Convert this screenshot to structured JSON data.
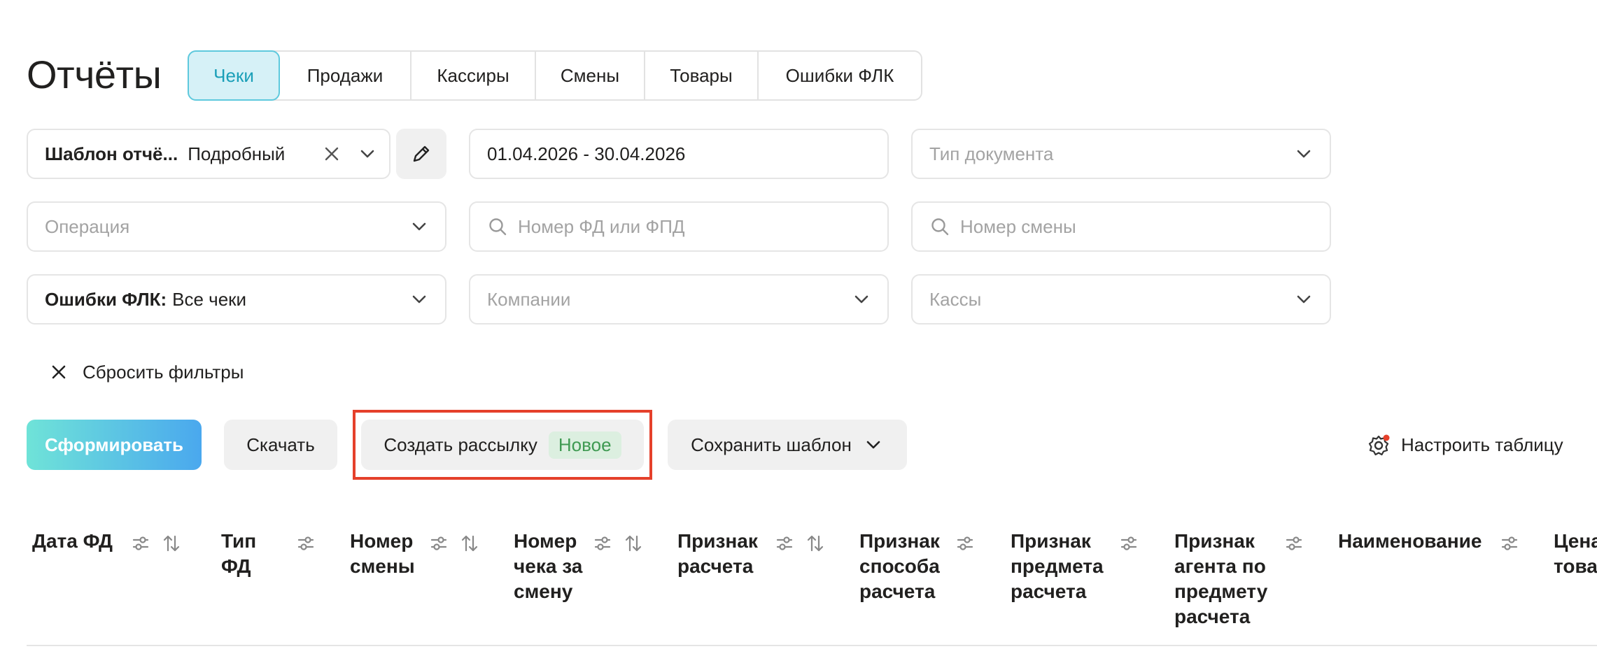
{
  "page": {
    "title": "Отчёты"
  },
  "tabs": [
    {
      "label": "Чеки",
      "active": true
    },
    {
      "label": "Продажи",
      "active": false
    },
    {
      "label": "Кассиры",
      "active": false
    },
    {
      "label": "Смены",
      "active": false
    },
    {
      "label": "Товары",
      "active": false
    },
    {
      "label": "Ошибки ФЛК",
      "active": false
    }
  ],
  "filters": {
    "template": {
      "label": "Шаблон отчё...",
      "value": "Подробный"
    },
    "date_range": {
      "value": "01.04.2026 - 30.04.2026"
    },
    "doc_type": {
      "placeholder": "Тип документа"
    },
    "operation": {
      "placeholder": "Операция"
    },
    "fd_number": {
      "placeholder": "Номер ФД или ФПД"
    },
    "shift_number": {
      "placeholder": "Номер смены"
    },
    "flk_errors": {
      "label": "Ошибки ФЛК:",
      "value": "Все чеки"
    },
    "companies": {
      "placeholder": "Компании"
    },
    "registers": {
      "placeholder": "Кассы"
    },
    "reset_label": "Сбросить фильтры"
  },
  "actions": {
    "generate": "Сформировать",
    "download": "Скачать",
    "mailing": "Создать рассылку",
    "mailing_badge": "Новое",
    "save_template": "Сохранить шаблон",
    "configure_table": "Настроить таблицу"
  },
  "table": {
    "columns": [
      {
        "label": "Дата ФД",
        "filter": true,
        "sort": true
      },
      {
        "label": "Тип ФД",
        "filter": true,
        "sort": false
      },
      {
        "label": "Номер смены",
        "filter": true,
        "sort": true
      },
      {
        "label": "Номер чека за смену",
        "filter": true,
        "sort": true
      },
      {
        "label": "Признак расчета",
        "filter": true,
        "sort": true
      },
      {
        "label": "Признак способа расчета",
        "filter": true,
        "sort": false
      },
      {
        "label": "Признак предмета расчета",
        "filter": true,
        "sort": false
      },
      {
        "label": "Признак агента по предмету расчета",
        "filter": true,
        "sort": false
      },
      {
        "label": "Наименование",
        "filter": true,
        "sort": false
      },
      {
        "label": "Цена товара",
        "filter": false,
        "sort": false
      }
    ]
  },
  "colors": {
    "accent": "#1a9fb8",
    "highlight": "#e5402b",
    "badge": "#3f9a52"
  }
}
